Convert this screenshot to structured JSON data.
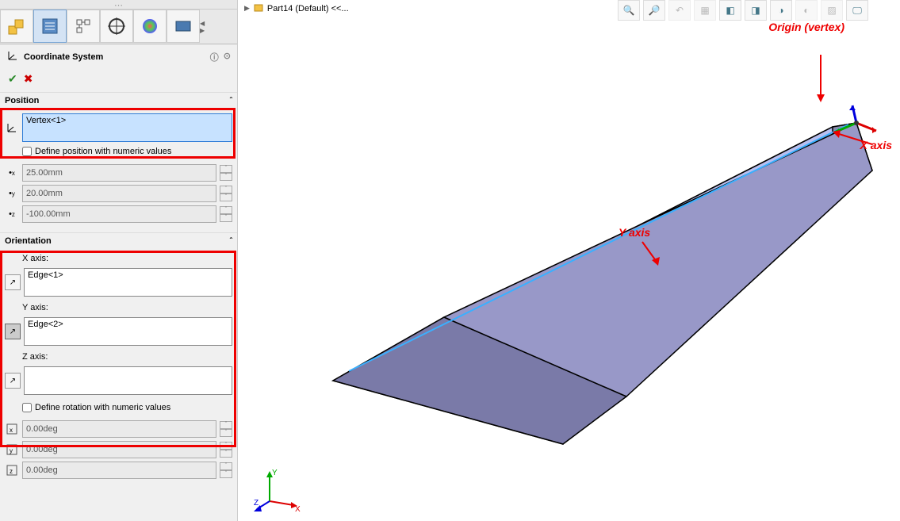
{
  "breadcrumb": {
    "part": "Part14 (Default) <<..."
  },
  "feature": {
    "title": "Coordinate System"
  },
  "position": {
    "header": "Position",
    "origin_selection": "Vertex<1>",
    "define_numeric_label": "Define position with numeric values",
    "x": "25.00mm",
    "y": "20.00mm",
    "z": "-100.00mm"
  },
  "orientation": {
    "header": "Orientation",
    "x_label": "X axis:",
    "x_sel": "Edge<1>",
    "y_label": "Y axis:",
    "y_sel": "Edge<2>",
    "z_label": "Z axis:",
    "z_sel": "",
    "define_numeric_label": "Define rotation with numeric values",
    "rx": "0.00deg",
    "ry": "0.00deg",
    "rz": "0.00deg"
  },
  "annotations": {
    "origin": "Origin (vertex)",
    "xaxis": "X axis",
    "yaxis": "Y axis"
  },
  "triad": {
    "x": "X",
    "y": "Y",
    "z": "Z"
  }
}
